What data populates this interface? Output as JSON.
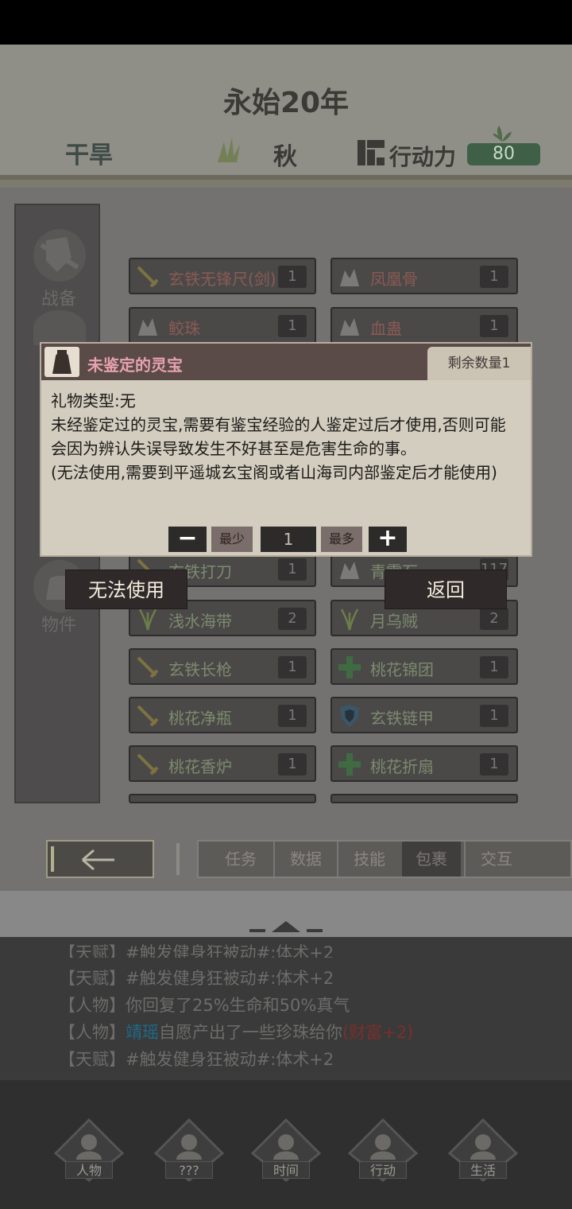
{
  "header": {
    "year": "永始20年",
    "weather": "干旱",
    "season": "秋",
    "action_label": "行动力",
    "action_value": "80"
  },
  "sidebar": {
    "items": [
      {
        "label": "战备",
        "icon": "armor-icon"
      },
      {
        "label": "物件",
        "icon": "bag-icon"
      }
    ]
  },
  "inventory": {
    "rows": [
      [
        {
          "name": "玄铁无锋尺(剑)",
          "count": "1",
          "icon": "sword-icon"
        },
        {
          "name": "凤凰骨",
          "count": "1",
          "icon": "material-icon"
        }
      ],
      [
        {
          "name": "鲛珠",
          "count": "1",
          "icon": "material-icon"
        },
        {
          "name": "血蛊",
          "count": "1",
          "icon": "material-icon"
        }
      ],
      [
        {
          "name": "玄铁打刀",
          "count": "1",
          "icon": "sword-icon"
        },
        {
          "name": "青霄石",
          "count": "117",
          "icon": "material-icon"
        }
      ],
      [
        {
          "name": "浅水海带",
          "count": "2",
          "icon": "herb-icon"
        },
        {
          "name": "月乌贼",
          "count": "2",
          "icon": "herb-icon"
        }
      ],
      [
        {
          "name": "玄铁长枪",
          "count": "1",
          "icon": "sword-icon"
        },
        {
          "name": "桃花锦团",
          "count": "1",
          "icon": "heal-icon"
        }
      ],
      [
        {
          "name": "桃花净瓶",
          "count": "1",
          "icon": "sword-icon"
        },
        {
          "name": "玄铁链甲",
          "count": "1",
          "icon": "shield-icon"
        }
      ],
      [
        {
          "name": "桃花香炉",
          "count": "1",
          "icon": "sword-icon"
        },
        {
          "name": "桃花折扇",
          "count": "1",
          "icon": "heal-icon"
        }
      ]
    ]
  },
  "tabs": [
    "任务",
    "数据",
    "技能",
    "包裹",
    "交互"
  ],
  "active_tab": "包裹",
  "log": {
    "partial": "【天赋】#触发健身狂被动#:体术+2",
    "lines": [
      {
        "prefix": "【天赋】",
        "text": "#触发健身狂被动#:体术+2"
      },
      {
        "prefix": "【人物】",
        "text": "你回复了25%生命和50%真气"
      },
      {
        "prefix": "【人物】",
        "name": "靖瑶",
        "text": "自愿产出了一些珍珠给你",
        "bonus": "(财富+2)"
      },
      {
        "prefix": "【天赋】",
        "text": "#触发健身狂被动#:体术+2"
      }
    ]
  },
  "bottom_nav": [
    "人物",
    "???",
    "时间",
    "行动",
    "生活"
  ],
  "dialog": {
    "title": "未鉴定的灵宝",
    "remaining": "剩余数量1",
    "type_line": "礼物类型:无",
    "desc1": "未经鉴定过的灵宝,需要有鉴宝经验的人鉴定过后才使用,否则可能",
    "desc2": "会因为辨认失误导致发生不好甚至是危害生命的事。",
    "desc3": "(无法使用,需要到平遥城玄宝阁或者山海司内部鉴定后才能使用)",
    "minus": "−",
    "min_label": "最少",
    "quantity": "1",
    "max_label": "最多",
    "plus": "+"
  },
  "actions": {
    "use": "无法使用",
    "back": "返回"
  },
  "colors": {
    "accent_green": "#3f5f46",
    "dialog_title": "#e6a2ad",
    "name_highlight": "#1e7fa6",
    "bonus_red": "#8a3a36"
  }
}
